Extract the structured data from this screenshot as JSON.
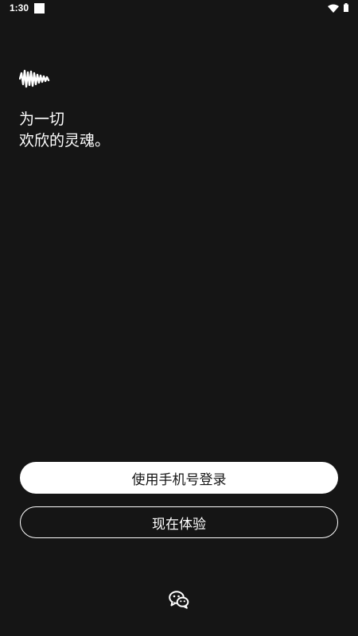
{
  "status_bar": {
    "time": "1:30"
  },
  "logo": {
    "icon": "soundwave-logo-icon"
  },
  "tagline": {
    "line1": "为一切",
    "line2": "欢欣的灵魂。"
  },
  "buttons": {
    "phone_login_label": "使用手机号登录",
    "try_now_label": "现在体验"
  },
  "social": {
    "wechat_icon": "wechat-icon"
  },
  "colors": {
    "background": "#151515",
    "foreground": "#ffffff"
  }
}
